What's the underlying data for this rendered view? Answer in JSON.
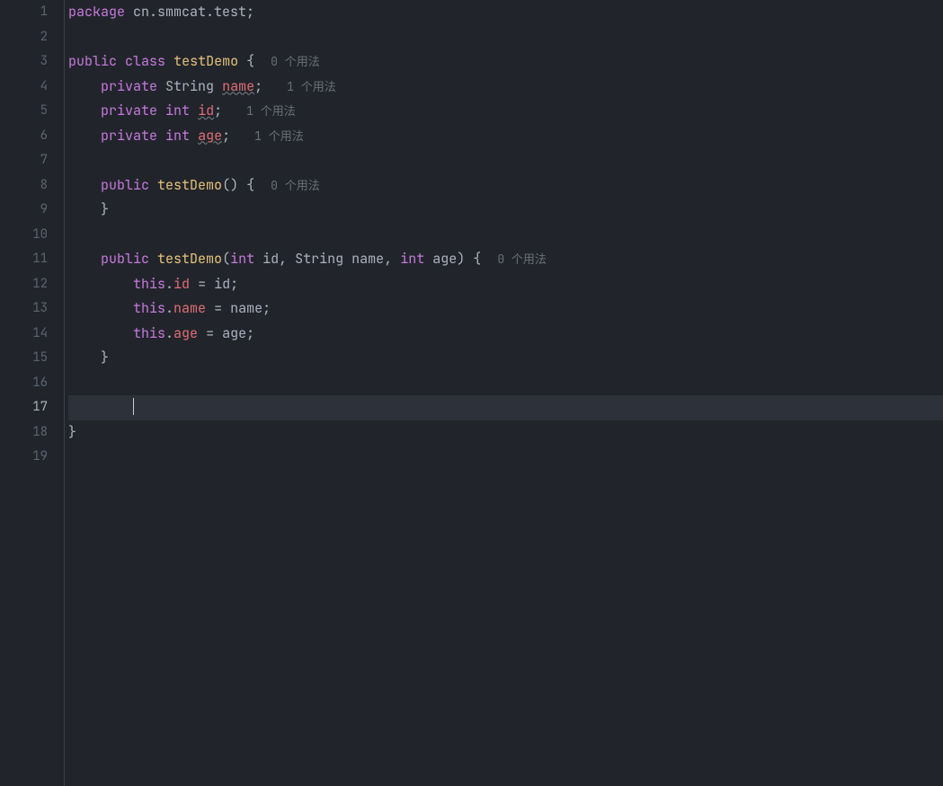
{
  "lineCount": 19,
  "currentLine": 17,
  "hints": {
    "usages0": "0 个用法",
    "usages1": "1 个用法"
  },
  "code": {
    "l1": {
      "package": "package",
      "sp": " ",
      "pkg": "cn.smmcat.test",
      "semi": ";"
    },
    "l3": {
      "public": "public",
      "class": "class",
      "name": "testDemo",
      "brace": "{"
    },
    "l4": {
      "private": "private",
      "type": "String",
      "field": "name",
      "semi": ";"
    },
    "l5": {
      "private": "private",
      "type": "int",
      "field": "id",
      "semi": ";"
    },
    "l6": {
      "private": "private",
      "type": "int",
      "field": "age",
      "semi": ";"
    },
    "l8": {
      "public": "public",
      "name": "testDemo",
      "parens": "()",
      "brace": "{"
    },
    "l9": {
      "brace": "}"
    },
    "l11": {
      "public": "public",
      "name": "testDemo",
      "open": "(",
      "t1": "int",
      "p1": "id",
      "c1": ", ",
      "t2": "String",
      "p2": "name",
      "c2": ", ",
      "t3": "int",
      "p3": "age",
      "close": ")",
      "brace": "{"
    },
    "l12": {
      "this": "this",
      "dot": ".",
      "field": "id",
      "eq": " = ",
      "rhs": "id",
      "semi": ";"
    },
    "l13": {
      "this": "this",
      "dot": ".",
      "field": "name",
      "eq": " = ",
      "rhs": "name",
      "semi": ";"
    },
    "l14": {
      "this": "this",
      "dot": ".",
      "field": "age",
      "eq": " = ",
      "rhs": "age",
      "semi": ";"
    },
    "l15": {
      "brace": "}"
    },
    "l18": {
      "brace": "}"
    }
  }
}
